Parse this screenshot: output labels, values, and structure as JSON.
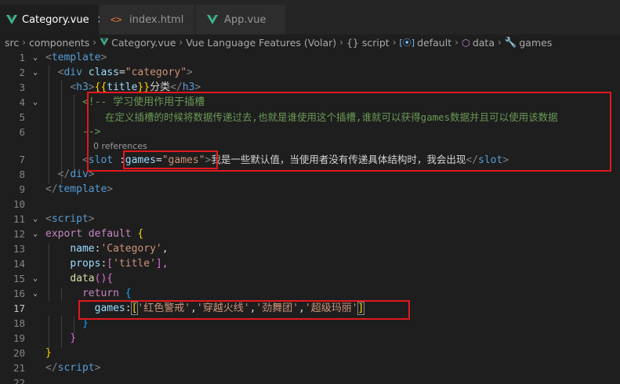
{
  "tabs": [
    {
      "label": "Category.vue",
      "close": "×",
      "icon": "vue-icon",
      "active": true
    },
    {
      "label": "index.html",
      "icon": "html-icon",
      "active": false
    },
    {
      "label": "App.vue",
      "icon": "vue-icon",
      "active": false
    }
  ],
  "breadcrumb": {
    "src": "src",
    "components": "components",
    "file": "Category.vue",
    "ext": "Vue Language Features (Volar)",
    "script": "{} script",
    "default": "default",
    "data": "data",
    "games": "games"
  },
  "codelens": "0 references",
  "lines": {
    "l1": [
      "<",
      "template",
      ">"
    ],
    "l2": [
      "<",
      "div",
      "class",
      "=",
      "\"category\"",
      ">"
    ],
    "l3": [
      "<",
      "h3",
      ">",
      "{{",
      "title",
      "}}",
      "分类",
      "</",
      "h3",
      ">"
    ],
    "l4": "<!-- 学习使用作用于插槽",
    "l5": "在定义插槽的时候将数据传递过去,也就是谁使用这个插槽,谁就可以获得games数据并且可以使用该数据",
    "l6": "-->",
    "l7": [
      "<",
      "slot",
      ":games",
      "=",
      "\"games\"",
      ">",
      "我是一些默认值，当使用者没有传递具体结构时，我会出现",
      "</",
      "slot",
      ">"
    ],
    "l8": [
      "</",
      "div",
      ">"
    ],
    "l9": [
      "</",
      "template",
      ">"
    ],
    "l11": [
      "<",
      "script",
      ">"
    ],
    "l12": [
      "export",
      "default",
      "{"
    ],
    "l13": [
      "name",
      ":",
      "'Category'",
      ","
    ],
    "l14": [
      "props",
      ":",
      "[",
      "'title'",
      "],"
    ],
    "l15": [
      "data",
      "(",
      ")",
      "{"
    ],
    "l16": [
      "return",
      "{"
    ],
    "l17": [
      "games",
      ":",
      "[",
      "'红色警戒'",
      ",",
      "'穿越火线'",
      ",",
      "'劲舞团'",
      ",",
      "'超级玛丽'",
      "]"
    ],
    "l18": "}",
    "l19": "}",
    "l20": "}",
    "l21": [
      "</",
      "script",
      ">"
    ]
  },
  "colors": {
    "background": "#1e1e1e",
    "highlight_box": "#e0191e",
    "tag": "#569cd6",
    "attribute": "#9cdcfe",
    "string": "#ce9178",
    "comment": "#6a9955"
  }
}
